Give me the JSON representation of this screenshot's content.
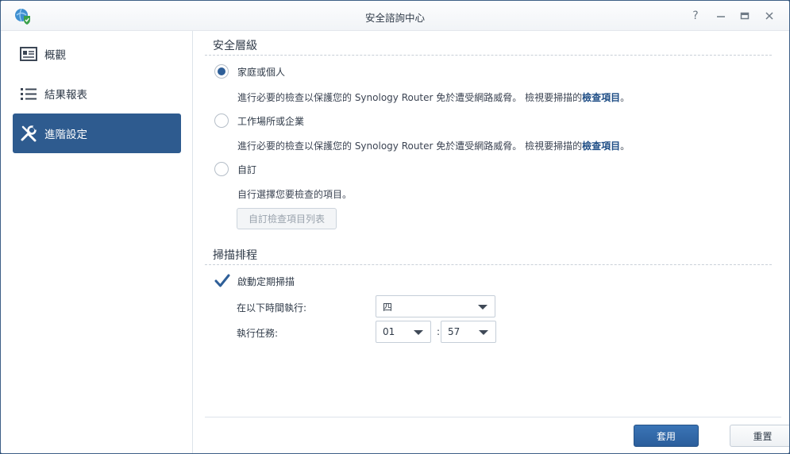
{
  "window": {
    "title": "安全諮詢中心",
    "controls": {
      "help": "?",
      "minimize": "—",
      "maximize": "▭",
      "close": "✕"
    }
  },
  "sidebar": {
    "items": [
      {
        "label": "概觀",
        "icon": "overview-icon",
        "active": false
      },
      {
        "label": "結果報表",
        "icon": "list-icon",
        "active": false
      },
      {
        "label": "進階設定",
        "icon": "tools-icon",
        "active": true
      }
    ]
  },
  "security_level": {
    "title": "安全層級",
    "options": [
      {
        "label": "家庭或個人",
        "checked": true,
        "desc": "進行必要的檢查以保護您的 Synology Router 免於遭受網路威脅。 檢視要掃描的",
        "link": "檢查項目",
        "suffix": "。"
      },
      {
        "label": "工作場所或企業",
        "checked": false,
        "desc": "進行必要的檢查以保護您的 Synology Router 免於遭受網路威脅。 檢視要掃描的",
        "link": "檢查項目",
        "suffix": "。"
      },
      {
        "label": "自訂",
        "checked": false,
        "desc": "自行選擇您要檢查的項目。"
      }
    ],
    "custom_button": "自訂檢查項目列表"
  },
  "schedule": {
    "title": "掃描排程",
    "enable_label": "啟動定期掃描",
    "enabled": true,
    "run_at_label": "在以下時間執行:",
    "day_value": "四",
    "task_label": "執行任務:",
    "hour_value": "01",
    "minute_value": "57",
    "separator": ":"
  },
  "footer": {
    "apply": "套用",
    "reset": "重置"
  },
  "colors": {
    "accent": "#2e5b8f",
    "link": "#1f4e86"
  }
}
